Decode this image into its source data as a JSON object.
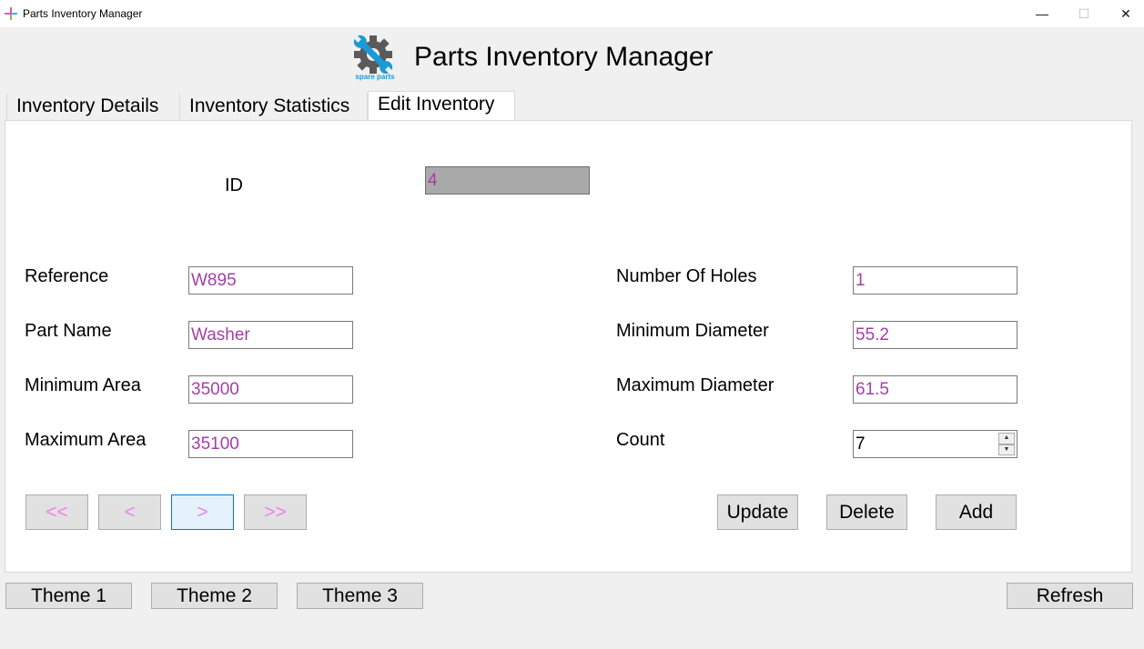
{
  "window": {
    "title": "Parts Inventory Manager",
    "minimize_glyph": "—",
    "maximize_glyph": "☐",
    "close_glyph": "✕"
  },
  "header": {
    "title": "Parts Inventory Manager",
    "logo_icon": "gear-wrench-icon",
    "logo_caption": "spare parts",
    "logo_colors": {
      "gear": "#5a5a5a",
      "wrench": "#1a9ad6"
    }
  },
  "tabs": [
    {
      "label": "Inventory Details",
      "active": false
    },
    {
      "label": "Inventory Statistics",
      "active": false
    },
    {
      "label": "Edit Inventory",
      "active": true
    }
  ],
  "form": {
    "id": {
      "label": "ID",
      "value": "4"
    },
    "reference": {
      "label": "Reference",
      "value": "W895"
    },
    "part_name": {
      "label": "Part Name",
      "value": "Washer"
    },
    "minimum_area": {
      "label": "Minimum Area",
      "value": "35000"
    },
    "maximum_area": {
      "label": "Maximum Area",
      "value": "35100"
    },
    "number_of_holes": {
      "label": "Number Of Holes",
      "value": "1"
    },
    "minimum_diameter": {
      "label": "Minimum Diameter",
      "value": "55.2"
    },
    "maximum_diameter": {
      "label": "Maximum Diameter",
      "value": "61.5"
    },
    "count": {
      "label": "Count",
      "value": "7"
    }
  },
  "navigation": {
    "first": "<<",
    "previous": "<",
    "next": ">",
    "last": ">>"
  },
  "actions": {
    "update": "Update",
    "delete": "Delete",
    "add": "Add"
  },
  "footer": {
    "theme1": "Theme 1",
    "theme2": "Theme 2",
    "theme3": "Theme 3",
    "refresh": "Refresh"
  },
  "colors": {
    "field_text": "#a43ea8",
    "nav_text": "#f080ec",
    "active_border": "#0078d7",
    "id_background": "#a9a9a9"
  }
}
